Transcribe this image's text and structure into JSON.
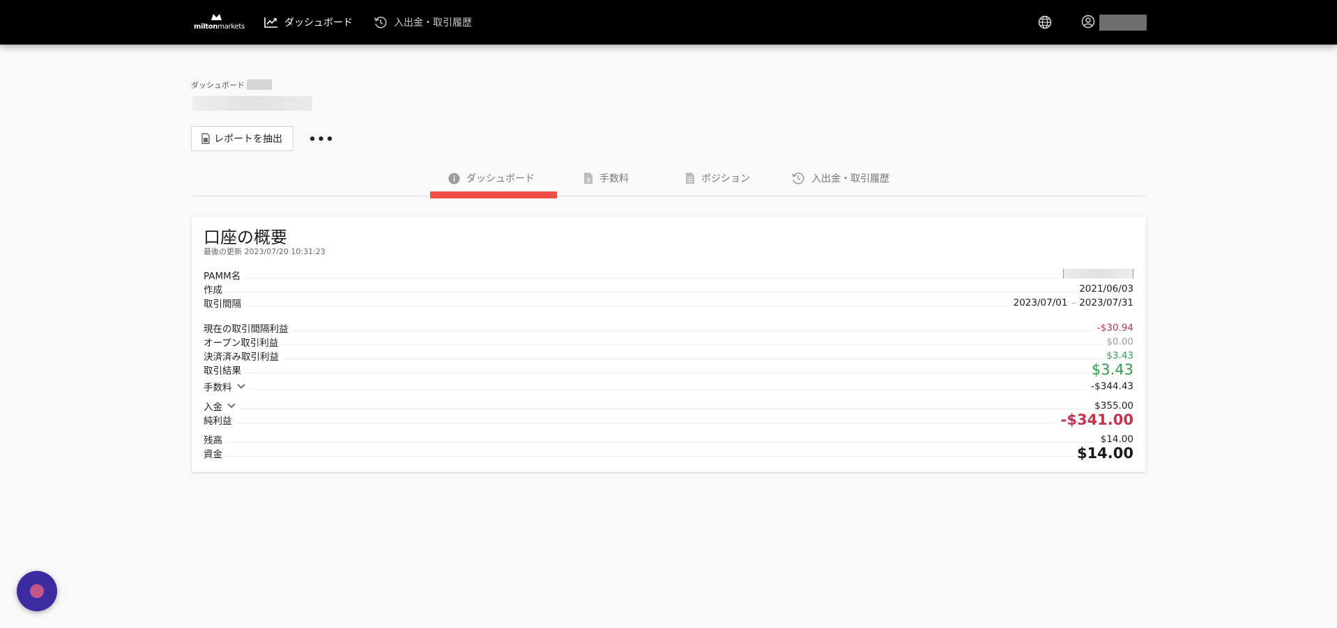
{
  "colors": {
    "topbar": "#000000",
    "accent_tab": "#f04e45",
    "negative": "#b3384b",
    "positive": "#3a9a55",
    "chat_fab": "#3b2ca0"
  },
  "topbar": {
    "logo_text": "miltonmarkets",
    "nav": [
      {
        "label": "ダッシュボード",
        "icon": "trend-chart-icon"
      },
      {
        "label": "入出金・取引履歴",
        "icon": "history-icon"
      }
    ],
    "globe_icon": "globe-icon",
    "user_icon": "user-circle-icon"
  },
  "header": {
    "breadcrumb": "ダッシュボード",
    "report_button": "レポートを抽出",
    "more_button": "•••"
  },
  "tabs": [
    {
      "label": "ダッシュボード",
      "icon": "info-icon",
      "active": true
    },
    {
      "label": "手数料",
      "icon": "fee-document-icon",
      "active": false
    },
    {
      "label": "ポジション",
      "icon": "document-icon",
      "active": false
    },
    {
      "label": "入出金・取引履歴",
      "icon": "history-icon",
      "active": false
    }
  ],
  "overview": {
    "title": "口座の概要",
    "updated": "最後の更新 2023/07/20 10:31:23",
    "rows": {
      "pamm_name": {
        "label": "PAMM名"
      },
      "created": {
        "label": "作成",
        "value": "2021/06/03"
      },
      "period": {
        "label": "取引間隔",
        "from": "2023/07/01",
        "sep": "–",
        "to": "2023/07/31"
      },
      "current_period_profit": {
        "label": "現在の取引間隔利益",
        "value": "-$30.94"
      },
      "open_profit": {
        "label": "オープン取引利益",
        "value": "$0.00"
      },
      "closed_profit": {
        "label": "決済済み取引利益",
        "value": "$3.43"
      },
      "trade_result": {
        "label": "取引結果",
        "value": "$3.43"
      },
      "fees": {
        "label": "手数料",
        "value": "-$344.43"
      },
      "deposit": {
        "label": "入金",
        "value": "$355.00"
      },
      "net_profit": {
        "label": "純利益",
        "value": "-$341.00"
      },
      "balance": {
        "label": "残高",
        "value": "$14.00"
      },
      "equity": {
        "label": "資金",
        "value": "$14.00"
      }
    }
  }
}
